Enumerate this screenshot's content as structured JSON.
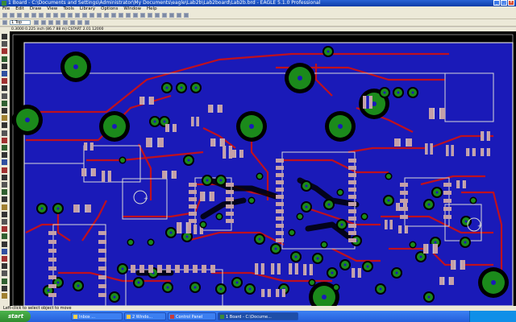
{
  "window": {
    "title": "1 Board - C:\\Documents and Settings\\Administrator\\My Documents\\eagle\\Lab2b\\Lab2board\\Lab2b.brd - EAGLE 5.1.0 Professional"
  },
  "menu": [
    "File",
    "Edit",
    "Draw",
    "View",
    "Tools",
    "Library",
    "Options",
    "Window",
    "Help"
  ],
  "toolbar": {
    "layer_value": "1 Top",
    "coord_readout": "0.3000 0.225 inch (86.7 88 m) CSTART 2.01 12000"
  },
  "status": {
    "hint": "Left-click to select object to move"
  },
  "taskbar": {
    "start_label": "start",
    "tasks": [
      "Inbox ...",
      "2 Windo...",
      "Control Panel",
      "1 Board - C:\\Docume..."
    ],
    "clock": ""
  },
  "colors": {
    "board": "#1a1ab8",
    "trace": "#c0101e",
    "pad": "#1b8a1b",
    "outline": "#d8d8d8",
    "smd": "#c4a0a8"
  }
}
